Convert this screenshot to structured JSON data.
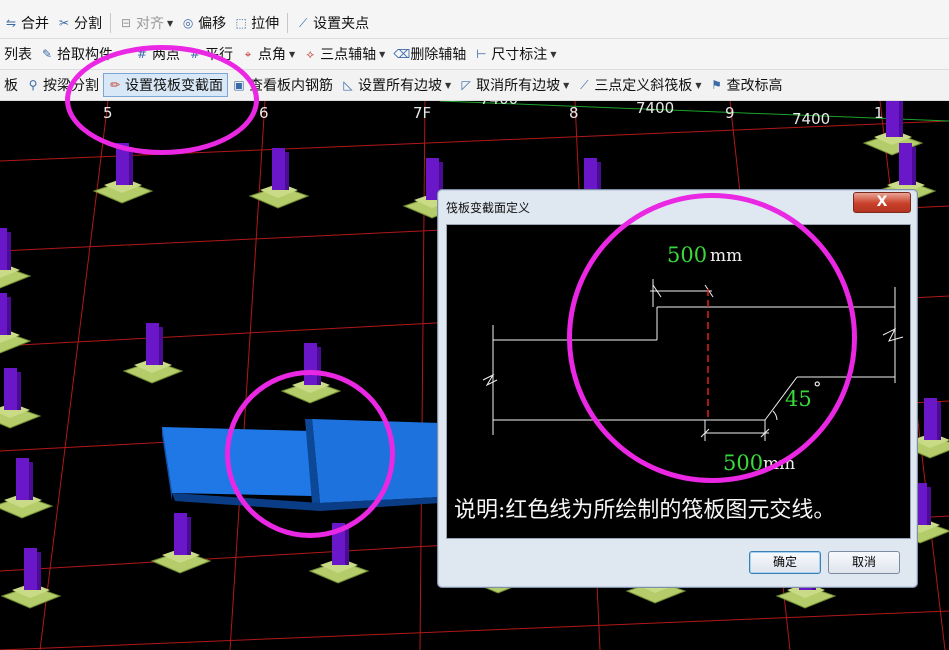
{
  "toolbar1": {
    "merge": "合并",
    "split": "分割",
    "align": "对齐",
    "offset": "偏移",
    "stretch": "拉伸",
    "grip": "设置夹点"
  },
  "toolbar2": {
    "list": "列表",
    "pick": "拾取构件",
    "two_point": "两点",
    "parallel": "平行",
    "point_angle": "点角",
    "three_point_aux": "三点辅轴",
    "delete_aux": "删除辅轴",
    "dimension": "尺寸标注"
  },
  "toolbar3": {
    "board": "板",
    "split_by_beam": "按梁分割",
    "set_section": "设置筏板变截面",
    "view_rebar": "查看板内钢筋",
    "set_all_slopes": "设置所有边坡",
    "cancel_all_slopes": "取消所有边坡",
    "three_point_slope": "三点定义斜筏板",
    "edit_elevation": "查改标高"
  },
  "axes": {
    "labels": [
      "5",
      "6",
      "7F",
      "8",
      "9",
      "1"
    ],
    "dims": [
      "7400",
      "7400",
      "7400"
    ]
  },
  "dialog": {
    "title": "筏板变截面定义",
    "close": "X",
    "dim_top_value": "500",
    "dim_top_unit": "mm",
    "dim_bottom_value": "500",
    "dim_bottom_unit": "mm",
    "angle_value": "45",
    "angle_unit": "°",
    "explanation": "说明:红色线为所绘制的筏板图元交线。",
    "ok": "确定",
    "cancel": "取消"
  },
  "colors": {
    "annotation": "#ea28e4",
    "grid": "#b01818",
    "slab": "#1f78e6",
    "column": "#6a16c9",
    "footing": "#b4cc6a",
    "dim_green": "#3ad93a"
  }
}
